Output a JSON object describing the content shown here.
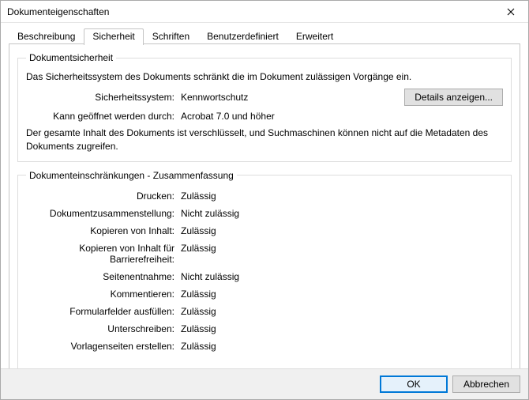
{
  "window": {
    "title": "Dokumenteigenschaften"
  },
  "tabs": {
    "t0": "Beschreibung",
    "t1": "Sicherheit",
    "t2": "Schriften",
    "t3": "Benutzerdefiniert",
    "t4": "Erweitert"
  },
  "securityGroup": {
    "legend": "Dokumentsicherheit",
    "intro": "Das Sicherheitssystem des Dokuments schränkt die im Dokument zulässigen Vorgänge ein.",
    "row1_label": "Sicherheitssystem:",
    "row1_value": "Kennwortschutz",
    "details_button": "Details anzeigen...",
    "row2_label": "Kann geöffnet werden durch:",
    "row2_value": "Acrobat 7.0 und höher",
    "note": "Der gesamte Inhalt des Dokuments ist verschlüsselt, und Suchmaschinen können nicht auf die Metadaten des Dokuments zugreifen."
  },
  "restrictGroup": {
    "legend": "Dokumenteinschränkungen - Zusammenfassung",
    "rows": {
      "r0_label": "Drucken:",
      "r0_value": "Zulässig",
      "r1_label": "Dokumentzusammenstellung:",
      "r1_value": "Nicht zulässig",
      "r2_label": "Kopieren von Inhalt:",
      "r2_value": "Zulässig",
      "r3_label": "Kopieren von Inhalt für Barrierefreiheit:",
      "r3_value": "Zulässig",
      "r4_label": "Seitenentnahme:",
      "r4_value": "Nicht zulässig",
      "r5_label": "Kommentieren:",
      "r5_value": "Zulässig",
      "r6_label": "Formularfelder ausfüllen:",
      "r6_value": "Zulässig",
      "r7_label": "Unterschreiben:",
      "r7_value": "Zulässig",
      "r8_label": "Vorlagenseiten erstellen:",
      "r8_value": "Zulässig"
    }
  },
  "footer": {
    "ok": "OK",
    "cancel": "Abbrechen"
  }
}
